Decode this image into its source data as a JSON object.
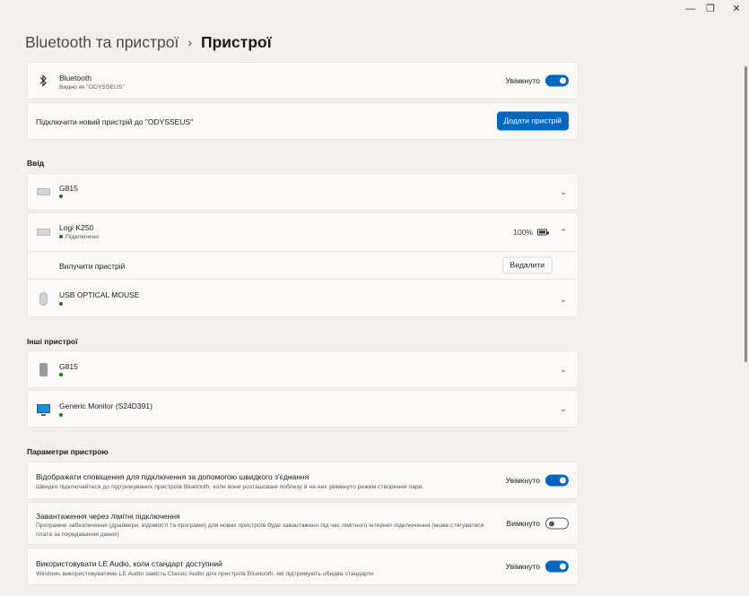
{
  "window": {
    "minimize": "—",
    "maximize": "❐",
    "close": "✕"
  },
  "breadcrumb": {
    "parent": "Bluetooth та пристрої",
    "separator": "›",
    "current": "Пристрої"
  },
  "bluetooth": {
    "title": "Bluetooth",
    "subtitle": "Видно як \"ODYSSEUS\"",
    "toggle_label": "Увімкнуто",
    "enabled": true
  },
  "add_device": {
    "label": "Підключити новий пристрій до \"ODYSSEUS\"",
    "button": "Додати пристрій"
  },
  "input_section": {
    "label": "Ввід",
    "devices": [
      {
        "name": "G815",
        "status": ""
      },
      {
        "name": "Logi K250",
        "status": "Підключено",
        "battery": "100%"
      },
      {
        "name": "USB OPTICAL MOUSE",
        "status": ""
      }
    ],
    "remove_row": {
      "label": "Вилучити пристрій",
      "button": "Видалити"
    }
  },
  "other_section": {
    "label": "Інші пристрої",
    "devices": [
      {
        "name": "G815"
      },
      {
        "name": "Generic Monitor (S24D391)"
      }
    ]
  },
  "settings_section": {
    "label": "Параметри пристрою",
    "items": [
      {
        "title": "Відображати сповіщення для підключення за допомогою швидкого з'єднання",
        "desc": "Швидко підключайтеся до підтримуваних пристроїв Bluetooth, коли вони розташовані поблизу й на них увімкнуто режим створення пари.",
        "toggle_label": "Увімкнуто",
        "enabled": true
      },
      {
        "title": "Завантаження через лімітні підключення",
        "desc": "Програмне забезпечення (драйвери, відомості та програми) для нових пристроїв буде завантажено під час лімітного інтернет-підключення (може стягуватися плата за передавання даних)",
        "toggle_label": "Вимкнуто",
        "enabled": false
      },
      {
        "title": "Використовувати LE Audio, коли стандарт доступний",
        "desc": "Windows використовуватиме LE Audio замість Classic Audio для пристроїв Bluetooth, які підтримують обидва стандарти",
        "toggle_label": "Увімкнуто",
        "enabled": true
      }
    ]
  },
  "colors": {
    "accent": "#0067c0",
    "background": "#f3efed",
    "card": "#fbfaf9",
    "status_green": "#0f7b0f"
  }
}
